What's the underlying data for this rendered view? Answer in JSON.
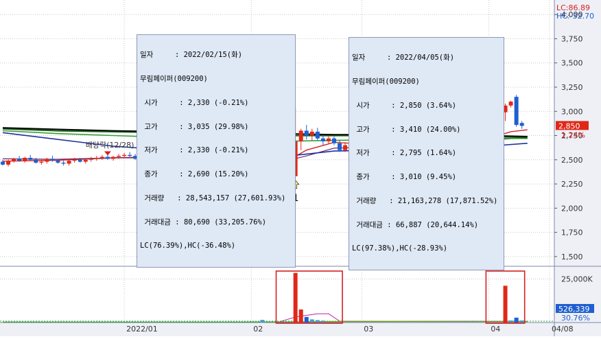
{
  "chart_data": {
    "type": "candlestick",
    "price_panel": {
      "ylim": [
        1400,
        4150
      ],
      "y_ticks": [
        {
          "value": 4000,
          "label": "4,000"
        },
        {
          "value": 3750,
          "label": "3,750"
        },
        {
          "value": 3500,
          "label": "3,500"
        },
        {
          "value": 3250,
          "label": "3,250"
        },
        {
          "value": 3000,
          "label": "3,000"
        },
        {
          "value": 2750,
          "label": "2,750"
        },
        {
          "value": 2500,
          "label": "2,500"
        },
        {
          "value": 2250,
          "label": "2,250"
        },
        {
          "value": 2000,
          "label": "2,000"
        },
        {
          "value": 1750,
          "label": "1,750"
        },
        {
          "value": 1500,
          "label": "1,500"
        }
      ],
      "lc_label": "LC:86.89",
      "hc_label": "HC:-32.70",
      "current_price_label": "2,850",
      "current_price": 2850,
      "current_change_label": "1.24%",
      "baeddang_label": "배당락(12/28)",
      "markers": [
        {
          "label": "1",
          "bar": 53,
          "price": 2330
        },
        {
          "label": "2",
          "bar": 90,
          "price": 2640
        }
      ],
      "dividend_markers": [
        {
          "bar": 19
        },
        {
          "bar": 41
        }
      ],
      "candles": [
        [
          2480,
          2500,
          2440,
          2450
        ],
        [
          2450,
          2500,
          2430,
          2490
        ],
        [
          2490,
          2520,
          2470,
          2510
        ],
        [
          2510,
          2540,
          2480,
          2490
        ],
        [
          2490,
          2530,
          2470,
          2520
        ],
        [
          2520,
          2550,
          2490,
          2500
        ],
        [
          2500,
          2520,
          2460,
          2470
        ],
        [
          2470,
          2500,
          2450,
          2480
        ],
        [
          2480,
          2520,
          2460,
          2510
        ],
        [
          2510,
          2540,
          2480,
          2490
        ],
        [
          2490,
          2510,
          2460,
          2470
        ],
        [
          2470,
          2490,
          2440,
          2460
        ],
        [
          2460,
          2500,
          2440,
          2490
        ],
        [
          2490,
          2520,
          2470,
          2500
        ],
        [
          2500,
          2520,
          2470,
          2480
        ],
        [
          2480,
          2510,
          2460,
          2500
        ],
        [
          2500,
          2530,
          2480,
          2510
        ],
        [
          2510,
          2540,
          2490,
          2520
        ],
        [
          2520,
          2550,
          2500,
          2530
        ],
        [
          2530,
          2560,
          2500,
          2510
        ],
        [
          2510,
          2540,
          2490,
          2530
        ],
        [
          2530,
          2560,
          2510,
          2540
        ],
        [
          2540,
          2570,
          2520,
          2550
        ],
        [
          2550,
          2580,
          2530,
          2540
        ],
        [
          2540,
          2560,
          2500,
          2510
        ],
        [
          2510,
          2540,
          2490,
          2520
        ],
        [
          2520,
          2550,
          2500,
          2530
        ],
        [
          2530,
          2560,
          2510,
          2540
        ],
        [
          2540,
          2570,
          2510,
          2520
        ],
        [
          2520,
          2540,
          2470,
          2490
        ],
        [
          2490,
          2510,
          2420,
          2440
        ],
        [
          2440,
          2470,
          2400,
          2420
        ],
        [
          2420,
          2440,
          2360,
          2380
        ],
        [
          2380,
          2400,
          2300,
          2320
        ],
        [
          2320,
          2340,
          2240,
          2260
        ],
        [
          2260,
          2290,
          2180,
          2200
        ],
        [
          2200,
          2240,
          2140,
          2170
        ],
        [
          2170,
          2260,
          2130,
          2240
        ],
        [
          2240,
          2290,
          2150,
          2180
        ],
        [
          2180,
          2230,
          2120,
          2140
        ],
        [
          2140,
          2280,
          2130,
          2260
        ],
        [
          2260,
          2360,
          2240,
          2340
        ],
        [
          2340,
          2420,
          2320,
          2400
        ],
        [
          2400,
          2480,
          2380,
          2460
        ],
        [
          2460,
          2500,
          2420,
          2440
        ],
        [
          2440,
          2520,
          2420,
          2500
        ],
        [
          2500,
          2560,
          2470,
          2480
        ],
        [
          2480,
          2520,
          2420,
          2440
        ],
        [
          2440,
          2480,
          2400,
          2470
        ],
        [
          2470,
          2560,
          2450,
          2540
        ],
        [
          2540,
          2580,
          2490,
          2500
        ],
        [
          2500,
          2540,
          2440,
          2460
        ],
        [
          2460,
          2480,
          2330,
          2340
        ],
        [
          2330,
          3035,
          2330,
          2690
        ],
        [
          2690,
          2820,
          2600,
          2800
        ],
        [
          2800,
          2860,
          2710,
          2750
        ],
        [
          2750,
          2820,
          2700,
          2790
        ],
        [
          2790,
          2830,
          2700,
          2720
        ],
        [
          2720,
          2760,
          2650,
          2690
        ],
        [
          2690,
          2740,
          2660,
          2720
        ],
        [
          2720,
          2740,
          2650,
          2670
        ],
        [
          2670,
          2700,
          2580,
          2600
        ],
        [
          2600,
          2680,
          2580,
          2650
        ],
        [
          2650,
          2690,
          2600,
          2620
        ],
        [
          2620,
          2680,
          2600,
          2660
        ],
        [
          2660,
          2740,
          2640,
          2710
        ],
        [
          2710,
          2740,
          2620,
          2640
        ],
        [
          2640,
          2690,
          2610,
          2670
        ],
        [
          2670,
          2690,
          2560,
          2580
        ],
        [
          2580,
          2610,
          2440,
          2460
        ],
        [
          2460,
          2520,
          2440,
          2500
        ],
        [
          2500,
          2560,
          2470,
          2540
        ],
        [
          2540,
          2560,
          2480,
          2500
        ],
        [
          2500,
          2540,
          2470,
          2520
        ],
        [
          2520,
          2560,
          2490,
          2500
        ],
        [
          2500,
          2560,
          2480,
          2550
        ],
        [
          2550,
          2620,
          2530,
          2600
        ],
        [
          2600,
          2640,
          2560,
          2580
        ],
        [
          2580,
          2640,
          2560,
          2620
        ],
        [
          2620,
          2680,
          2600,
          2660
        ],
        [
          2660,
          2720,
          2640,
          2700
        ],
        [
          2700,
          2760,
          2680,
          2740
        ],
        [
          2740,
          2780,
          2700,
          2720
        ],
        [
          2720,
          2800,
          2700,
          2780
        ],
        [
          2780,
          2820,
          2740,
          2760
        ],
        [
          2760,
          2820,
          2740,
          2800
        ],
        [
          2800,
          2840,
          2720,
          2740
        ],
        [
          2740,
          2800,
          2720,
          2790
        ],
        [
          2790,
          2830,
          2740,
          2760
        ],
        [
          2760,
          2820,
          2720,
          2790
        ],
        [
          2750,
          3410,
          2700,
          2990
        ],
        [
          2990,
          3080,
          2900,
          3060
        ],
        [
          3060,
          3110,
          3040,
          3100
        ],
        [
          3150,
          3170,
          2840,
          2860
        ],
        [
          2880,
          2900,
          2820,
          2850
        ]
      ],
      "moving_averages": [
        {
          "color": "#d42020",
          "width": 1.4,
          "points": [
            [
              0,
              2485
            ],
            [
              10,
              2495
            ],
            [
              20,
              2520
            ],
            [
              28,
              2530
            ],
            [
              33,
              2400
            ],
            [
              37,
              2260
            ],
            [
              40,
              2225
            ],
            [
              45,
              2360
            ],
            [
              50,
              2440
            ],
            [
              55,
              2600
            ],
            [
              60,
              2680
            ],
            [
              66,
              2660
            ],
            [
              72,
              2560
            ],
            [
              78,
              2570
            ],
            [
              84,
              2660
            ],
            [
              88,
              2720
            ],
            [
              92,
              2790
            ],
            [
              95,
              2810
            ]
          ]
        },
        {
          "color": "#6a2a6a",
          "width": 1.2,
          "points": [
            [
              0,
              2510
            ],
            [
              10,
              2505
            ],
            [
              20,
              2520
            ],
            [
              30,
              2520
            ],
            [
              35,
              2450
            ],
            [
              40,
              2390
            ],
            [
              45,
              2410
            ],
            [
              50,
              2470
            ],
            [
              55,
              2540
            ],
            [
              60,
              2620
            ],
            [
              66,
              2630
            ],
            [
              72,
              2580
            ],
            [
              78,
              2580
            ],
            [
              84,
              2640
            ],
            [
              90,
              2710
            ],
            [
              95,
              2730
            ]
          ]
        },
        {
          "color": "#2030a0",
          "width": 1.6,
          "points": [
            [
              0,
              2780
            ],
            [
              10,
              2710
            ],
            [
              20,
              2640
            ],
            [
              30,
              2600
            ],
            [
              38,
              2560
            ],
            [
              45,
              2530
            ],
            [
              52,
              2540
            ],
            [
              60,
              2590
            ],
            [
              70,
              2600
            ],
            [
              80,
              2610
            ],
            [
              88,
              2640
            ],
            [
              95,
              2670
            ]
          ]
        },
        {
          "color": "#30a030",
          "width": 1.6,
          "points": [
            [
              0,
              2800
            ],
            [
              10,
              2770
            ],
            [
              20,
              2750
            ],
            [
              30,
              2730
            ],
            [
              40,
              2700
            ],
            [
              50,
              2690
            ],
            [
              60,
              2700
            ],
            [
              70,
              2710
            ],
            [
              80,
              2710
            ],
            [
              88,
              2720
            ],
            [
              95,
              2720
            ]
          ]
        },
        {
          "color": "#1a5a1a",
          "width": 2.2,
          "points": [
            [
              0,
              2820
            ],
            [
              10,
              2800
            ],
            [
              20,
              2790
            ],
            [
              30,
              2780
            ],
            [
              40,
              2760
            ],
            [
              50,
              2750
            ],
            [
              60,
              2750
            ],
            [
              70,
              2750
            ],
            [
              80,
              2740
            ],
            [
              88,
              2740
            ],
            [
              95,
              2730
            ]
          ]
        },
        {
          "color": "#000000",
          "width": 1.8,
          "points": [
            [
              0,
              2830
            ],
            [
              10,
              2815
            ],
            [
              20,
              2800
            ],
            [
              30,
              2790
            ],
            [
              40,
              2780
            ],
            [
              50,
              2770
            ],
            [
              60,
              2760
            ],
            [
              70,
              2760
            ],
            [
              80,
              2755
            ],
            [
              88,
              2750
            ],
            [
              95,
              2740
            ]
          ]
        }
      ]
    },
    "volume_panel": {
      "y_tick_label": "25,000K",
      "y_tick_value": 25000,
      "ylim": [
        0,
        30000
      ],
      "current_volume_label": "526,339",
      "current_ratio_label": "30.76%",
      "bars": [
        {
          "bar": 40,
          "value": 220
        },
        {
          "bar": 47,
          "value": 1500
        },
        {
          "bar": 53,
          "value": 28543
        },
        {
          "bar": 54,
          "value": 7500
        },
        {
          "bar": 55,
          "value": 3200
        },
        {
          "bar": 56,
          "value": 1800
        },
        {
          "bar": 57,
          "value": 1400
        },
        {
          "bar": 58,
          "value": 1100
        },
        {
          "bar": 91,
          "value": 21163
        },
        {
          "bar": 92,
          "value": 1200
        },
        {
          "bar": 93,
          "value": 2800
        },
        {
          "bar": 94,
          "value": 1200
        }
      ],
      "highlight_boxes": [
        {
          "from_bar": 50,
          "to_bar": 61
        },
        {
          "from_bar": 88,
          "to_bar": 94
        }
      ],
      "ma_lines": [
        {
          "color": "#c020a0",
          "points": [
            [
              50,
              300
            ],
            [
              53,
              3200
            ],
            [
              57,
              5000
            ],
            [
              59,
              5000
            ],
            [
              61,
              800
            ],
            [
              95,
              700
            ]
          ]
        },
        {
          "color": "#c8a020",
          "points": [
            [
              55,
              600
            ],
            [
              70,
              800
            ],
            [
              85,
              600
            ],
            [
              95,
              700
            ]
          ]
        },
        {
          "color": "#30a030",
          "points": [
            [
              0,
              300
            ],
            [
              40,
              300
            ],
            [
              70,
              500
            ],
            [
              95,
              500
            ]
          ]
        }
      ]
    },
    "x_axis": {
      "ticks": [
        {
          "bar": 22,
          "label": "2022/01"
        },
        {
          "bar": 45,
          "label": "02"
        },
        {
          "bar": 65,
          "label": "03"
        },
        {
          "bar": 88,
          "label": "04"
        },
        {
          "bar": 99,
          "label": "04/08"
        }
      ]
    }
  },
  "tooltips": [
    {
      "date_label": "일자",
      "date_value": ": 2022/02/15(화)",
      "name": "무림페이퍼(009200)",
      "rows": [
        {
          "label": "시가",
          "value": ": 2,330 (-0.21%)"
        },
        {
          "label": "고가",
          "value": ": 3,035 (29.98%)"
        },
        {
          "label": "저가",
          "value": ": 2,330 (-0.21%)"
        },
        {
          "label": "종가",
          "value": ": 2,690 (15.20%)"
        },
        {
          "label": "거래량",
          "value": ": 28,543,157 (27,601.93%)"
        },
        {
          "label": "거래대금",
          "value": ": 80,690 (33,205.76%)"
        }
      ],
      "footer": "LC(76.39%),HC(-36.48%)"
    },
    {
      "date_label": "일자",
      "date_value": ": 2022/04/05(화)",
      "name": "무림페이퍼(009200)",
      "rows": [
        {
          "label": "시가",
          "value": ": 2,850 (3.64%)"
        },
        {
          "label": "고가",
          "value": ": 3,410 (24.00%)"
        },
        {
          "label": "저가",
          "value": ": 2,795 (1.64%)"
        },
        {
          "label": "종가",
          "value": ": 3,010 (9.45%)"
        },
        {
          "label": "거래량",
          "value": ": 21,163,278 (17,871.52%)"
        },
        {
          "label": "거래대금",
          "value": ": 66,887 (20,644.14%)"
        }
      ],
      "footer": "LC(97.38%),HC(-28.93%)"
    }
  ],
  "colors": {
    "up": "#e02818",
    "down": "#1f5fd0",
    "grid": "#c8c8c8",
    "axis_bg": "#eef0f6",
    "highlight": "#d42020"
  }
}
